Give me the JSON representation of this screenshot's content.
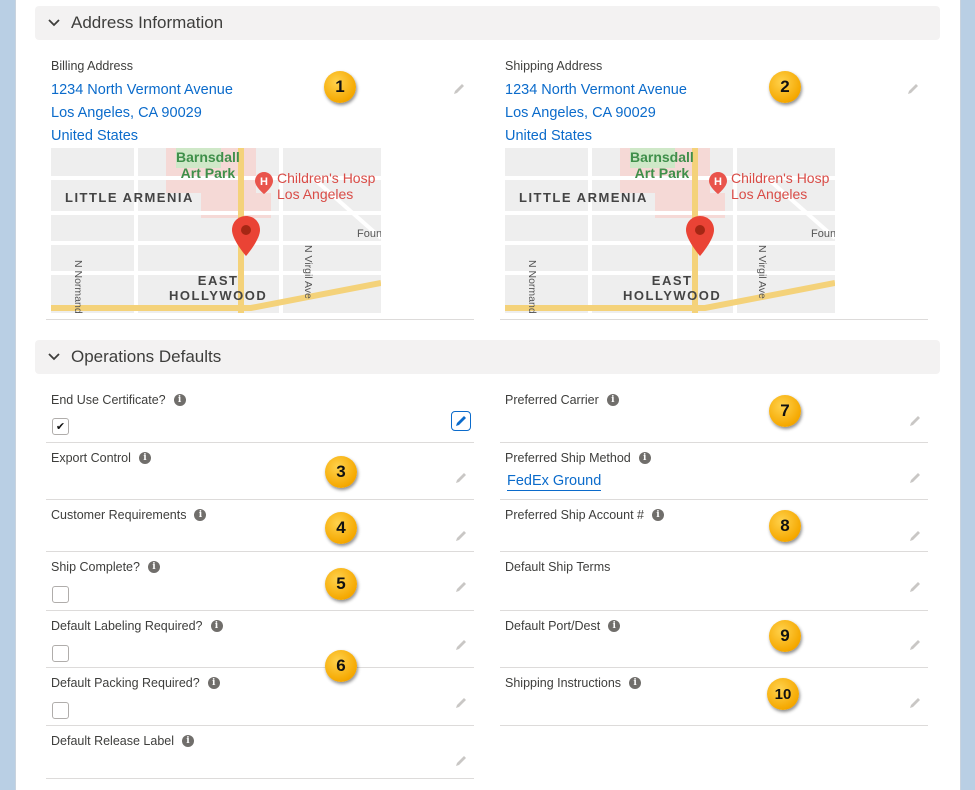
{
  "address_section": {
    "title": "Address Information",
    "billing": {
      "label": "Billing Address",
      "street": "1234 North Vermont Avenue",
      "city_line": "Los Angeles, CA 90029",
      "country": "United States",
      "badge": "1"
    },
    "shipping": {
      "label": "Shipping Address",
      "street": "1234 North Vermont Avenue",
      "city_line": "Los Angeles, CA 90029",
      "country": "United States",
      "badge": "2"
    },
    "map": {
      "park_line1": "Barnsdall",
      "park_line2": "Art Park",
      "hospital_line1": "Children's Hosp",
      "hospital_line2": "Los Angeles",
      "district1": "LITTLE ARMENIA",
      "district2_line1": "EAST",
      "district2_line2": "HOLLYWOOD",
      "street1": "N Normandie Ave",
      "street2": "N Virgil Ave",
      "edge_text": "Foun"
    }
  },
  "operations_section": {
    "title": "Operations Defaults",
    "left": [
      {
        "label": "End Use Certificate?",
        "badge": "",
        "checked": true
      },
      {
        "label": "Export Control",
        "badge": "3"
      },
      {
        "label": "Customer Requirements",
        "badge": "4"
      },
      {
        "label": "Ship Complete?",
        "badge": "5",
        "checked": false
      },
      {
        "label": "Default Labeling Required?",
        "badge": "6",
        "checked": false
      },
      {
        "label": "Default Packing Required?",
        "checked": false
      },
      {
        "label": "Default Release Label"
      }
    ],
    "right": [
      {
        "label": "Preferred Carrier",
        "badge": "7"
      },
      {
        "label": "Preferred Ship Method",
        "value": "FedEx Ground"
      },
      {
        "label": "Preferred Ship Account #",
        "badge": "8"
      },
      {
        "label": "Default Ship Terms"
      },
      {
        "label": "Default Port/Dest",
        "badge": "9"
      },
      {
        "label": "Shipping Instructions",
        "badge": "10"
      }
    ]
  },
  "icons": {
    "info": "i",
    "check": "✔"
  },
  "colors": {
    "link": "#0b6bcb",
    "badge": "#f5a800",
    "header_bg": "#f3f2f2"
  }
}
